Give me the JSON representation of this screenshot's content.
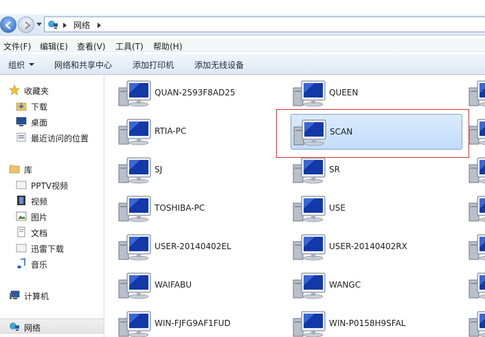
{
  "address_bar": {
    "crumbs": [
      "网络"
    ]
  },
  "menu": {
    "items": [
      "文件(F)",
      "编辑(E)",
      "查看(V)",
      "工具(T)",
      "帮助(H)"
    ]
  },
  "toolbar": {
    "organize": "组织",
    "network_center": "网络和共享中心",
    "add_printer": "添加打印机",
    "add_wireless": "添加无线设备"
  },
  "nav": {
    "favorites": {
      "label": "收藏夹",
      "items": [
        "下载",
        "桌面",
        "最近访问的位置"
      ]
    },
    "libraries": {
      "label": "库",
      "items": [
        "PPTV视频",
        "视频",
        "图片",
        "文档",
        "迅雷下载",
        "音乐"
      ]
    },
    "computer": "计算机",
    "network": "网络"
  },
  "computers": {
    "col1": [
      "QUAN-2593F8AD25",
      "RTIA-PC",
      "SJ",
      "TOSHIBA-PC",
      "USER-20140402EL",
      "WAIFABU",
      "WIN-FJFG9AF1FUD"
    ],
    "col2": [
      "QUEEN",
      "SCAN",
      "SR",
      "USE",
      "USER-20140402RX",
      "WANGC",
      "WIN-P0158H9SFAL"
    ],
    "selected": "SCAN"
  },
  "colors": {
    "highlight": "#c1dcfc",
    "callout": "#d6302c"
  }
}
